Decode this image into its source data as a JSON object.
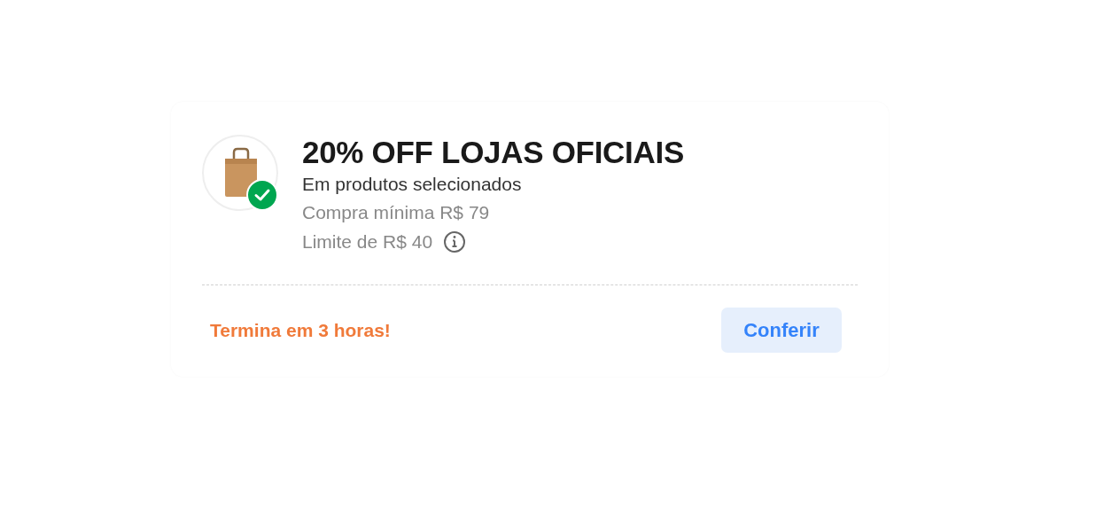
{
  "coupon": {
    "activated": true,
    "title": "20% OFF LOJAS OFICIAIS",
    "subtitle": "Em produtos selecionados",
    "details": [
      "Compra mínima R$ 79",
      "Limite de R$ 40"
    ],
    "expiry": "Termina em 3 horas!",
    "button": "Conferir"
  }
}
